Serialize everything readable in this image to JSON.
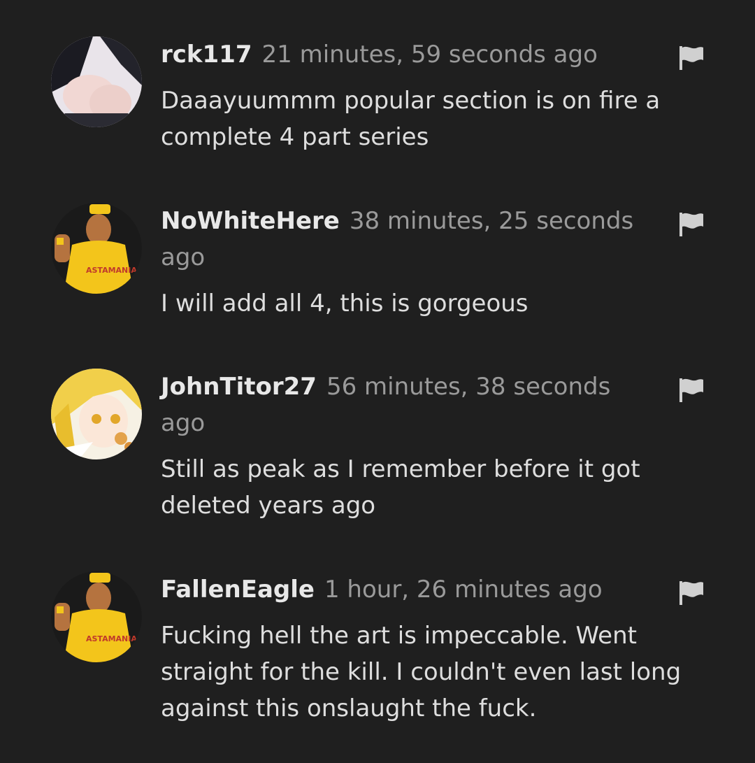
{
  "comments": [
    {
      "username": "rck117",
      "timestamp": "21 minutes, 59 seconds ago",
      "text": "Daaayuummm popular section is on fire a complete 4 part series",
      "avatar_icon": "anime-character-avatar-icon"
    },
    {
      "username": "NoWhiteHere",
      "timestamp": "38 minutes, 25 seconds ago",
      "text": "I will add all 4, this is gorgeous",
      "avatar_icon": "wrestler-avatar-icon"
    },
    {
      "username": "JohnTitor27",
      "timestamp": "56 minutes, 38 seconds ago",
      "text": "Still as peak as I remember before it got deleted years ago",
      "avatar_icon": "anime-blonde-girl-avatar-icon"
    },
    {
      "username": "FallenEagle",
      "timestamp": "1 hour, 26 minutes ago",
      "text": "Fucking hell the art is impeccable. Went straight for the kill. I couldn't even last long against this onslaught the fuck.",
      "avatar_icon": "wrestler-avatar-icon"
    }
  ],
  "colors": {
    "background": "#1f1f1f",
    "username": "#e8e8e8",
    "timestamp": "#9a9a9a",
    "text": "#dedede",
    "flag": "#d0d0d0"
  }
}
